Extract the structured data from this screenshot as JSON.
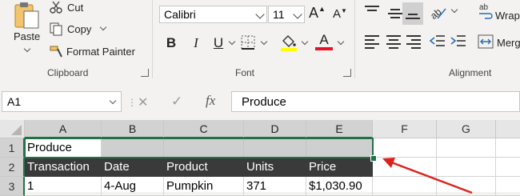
{
  "ribbon": {
    "clipboard": {
      "cut": "Cut",
      "copy": "Copy",
      "paste": "Paste",
      "format_painter": "Format Painter",
      "label": "Clipboard"
    },
    "font": {
      "family": "Calibri",
      "size": "11",
      "bold": "B",
      "italic": "I",
      "underline": "U",
      "grow": "A",
      "shrink": "A",
      "font_color_letter": "A",
      "label": "Font"
    },
    "alignment": {
      "wrap": "Wrap",
      "merge": "Merg",
      "label": "Alignment"
    },
    "colors": {
      "accent": "#217346",
      "highlight_yellow": "#ffff00",
      "font_red": "#e81123"
    }
  },
  "formula_bar": {
    "name_box": "A1",
    "fx": "fx",
    "cancel": "✕",
    "enter": "✓",
    "content": "Produce"
  },
  "sheet": {
    "columns": [
      "A",
      "B",
      "C",
      "D",
      "E",
      "F",
      "G"
    ],
    "rows": [
      "1",
      "2",
      "3"
    ],
    "cells": {
      "a1": "Produce",
      "headers": [
        "Transaction",
        "Date",
        "Product",
        "Units",
        "Price"
      ],
      "row3": [
        "1",
        "4-Aug",
        "Pumpkin",
        "371",
        "$1,030.90"
      ]
    }
  }
}
